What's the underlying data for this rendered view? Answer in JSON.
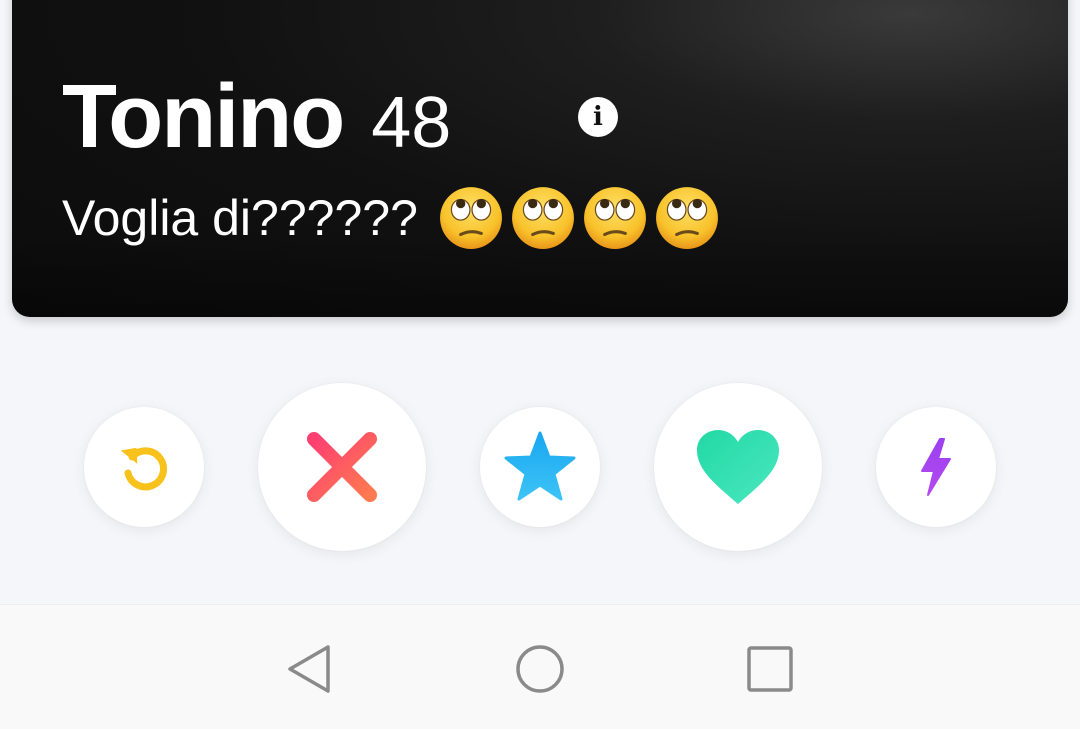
{
  "profile": {
    "name": "Tonino",
    "age": "48",
    "bio": "Voglia di??????",
    "bio_emojis": [
      "face-with-rolling-eyes-icon",
      "face-with-rolling-eyes-icon",
      "face-with-rolling-eyes-icon",
      "face-with-rolling-eyes-icon"
    ],
    "info_icon": "info-icon"
  },
  "actions": [
    {
      "name": "rewind",
      "icon": "rewind-icon",
      "color": "#f7c21b"
    },
    {
      "name": "nope",
      "icon": "x-icon",
      "color": "#fd5068"
    },
    {
      "name": "super-like",
      "icon": "star-icon",
      "color": "#2db5f5"
    },
    {
      "name": "like",
      "icon": "heart-icon",
      "color": "#2fe0a6"
    },
    {
      "name": "boost",
      "icon": "lightning-icon",
      "color": "#a23eed"
    }
  ],
  "navigation": {
    "back_icon": "back-triangle-icon",
    "home_icon": "home-circle-icon",
    "recents_icon": "recents-square-icon"
  }
}
